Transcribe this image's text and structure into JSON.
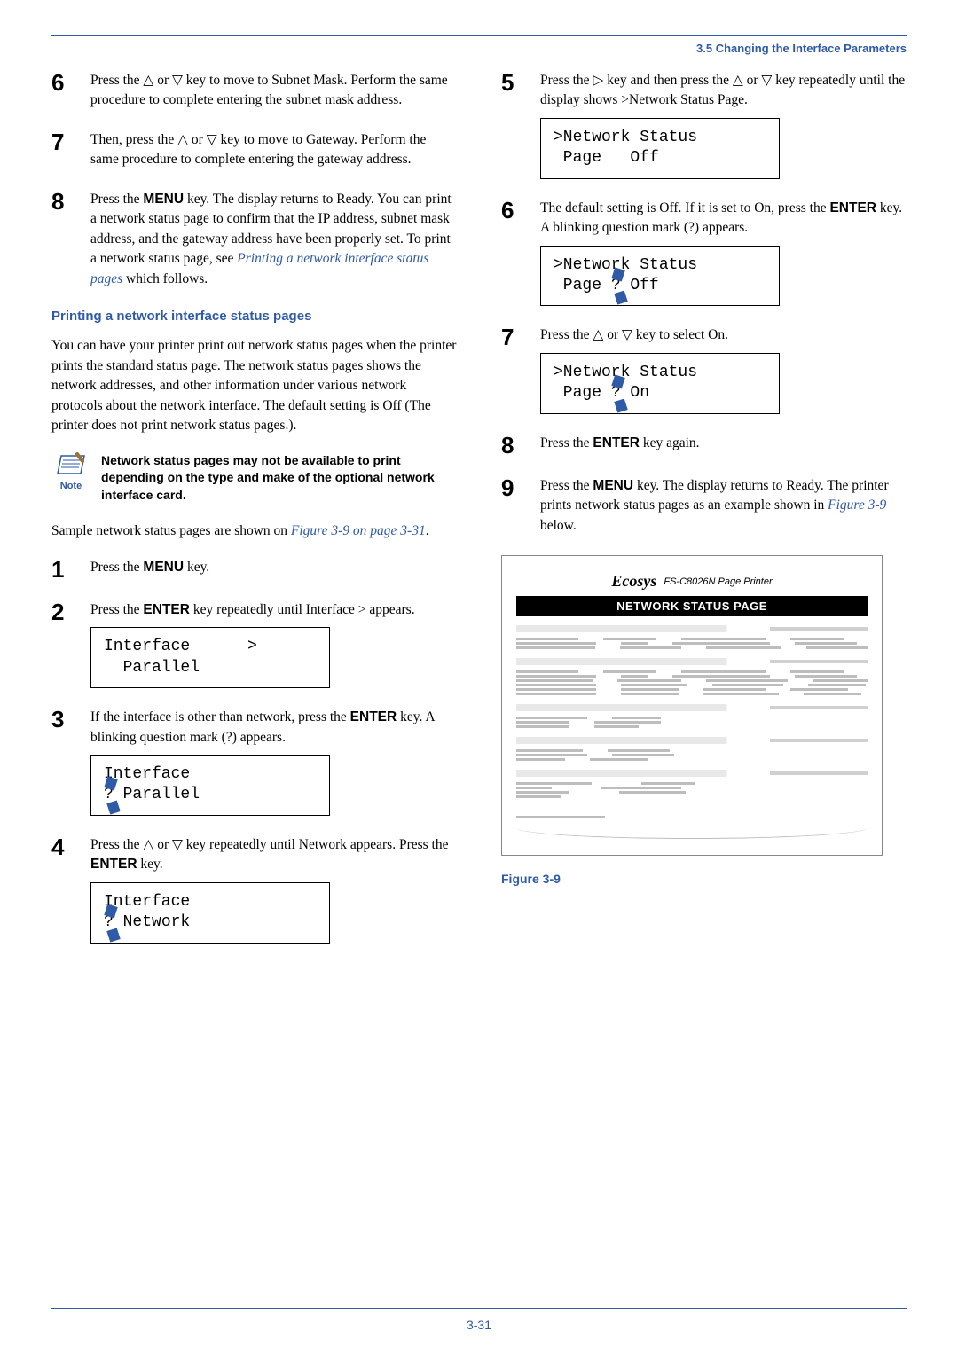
{
  "header": {
    "section": "3.5 Changing the Interface Parameters"
  },
  "left": {
    "step6": "Press the △ or ▽ key to move to Subnet Mask. Perform the same procedure to complete entering the subnet mask address.",
    "step7": "Then, press the △ or ▽ key to move to Gateway. Perform the same procedure to complete entering the gateway address.",
    "step8_a": "Press the ",
    "step8_menu": "MENU",
    "step8_b": " key. The display returns to Ready. You can print a network status page to confirm that the IP address, subnet mask address, and the gateway address have been properly set. To print a network status page, see ",
    "step8_link": "Printing a network interface status pages",
    "step8_c": " which follows.",
    "heading": "Printing a network interface status pages",
    "intro": "You can have your printer print out network status pages when the printer prints the standard status page. The network status pages shows the network addresses, and other information under various network protocols about the network interface. The default setting is Off (The printer does not print network status pages.).",
    "note_label": "Note",
    "note_text": "Network status pages may not be available to print depending on the type and make of the optional network interface card.",
    "sample_a": "Sample network status pages are shown on ",
    "sample_link": "Figure 3-9 on page 3-31",
    "sample_b": ".",
    "s1_a": "Press the ",
    "s1_menu": "MENU",
    "s1_b": " key.",
    "s2_a": "Press the ",
    "s2_enter": "ENTER",
    "s2_b": " key repeatedly until Interface > appears.",
    "lcd2": "Interface      >\n  Parallel",
    "s3_a": "If the interface is other than network, press the ",
    "s3_enter": "ENTER",
    "s3_b": " key. A blinking question mark (?) appears.",
    "lcd3a": "Interface",
    "lcd3b": " Parallel",
    "s4_a": "Press the △ or ▽ key repeatedly until Network appears. Press the ",
    "s4_enter": "ENTER",
    "s4_b": " key.",
    "lcd4a": "Interface",
    "lcd4b": " Network"
  },
  "right": {
    "s5_a": "Press the ▷ key and then press the △ or ▽ key repeatedly until the display shows >Network Status Page.",
    "lcd5": ">Network Status\n Page   Off",
    "s6_a": "The default setting is Off. If it is set to On, press the ",
    "s6_enter": "ENTER",
    "s6_b": " key. A blinking question mark (?) appears.",
    "lcd6a": ">Network Status",
    "lcd6b": " Page ",
    "lcd6c": " Off",
    "s7": "Press the △ or ▽ key to select On.",
    "lcd7a": ">Network Status",
    "lcd7b": " Page ",
    "lcd7c": " On",
    "s8_a": "Press the ",
    "s8_enter": "ENTER",
    "s8_b": " key again.",
    "s9_a": "Press the ",
    "s9_menu": "MENU",
    "s9_b": " key. The display returns to Ready. The printer prints network status pages as an example shown in ",
    "s9_link": "Figure 3-9",
    "s9_c": " below.",
    "fig_logo": "Ecosys",
    "fig_sub": "FS-C8026N  Page Printer",
    "fig_title": "NETWORK STATUS PAGE",
    "fig_caption": "Figure 3-9"
  },
  "footer": {
    "pagenum": "3-31"
  }
}
